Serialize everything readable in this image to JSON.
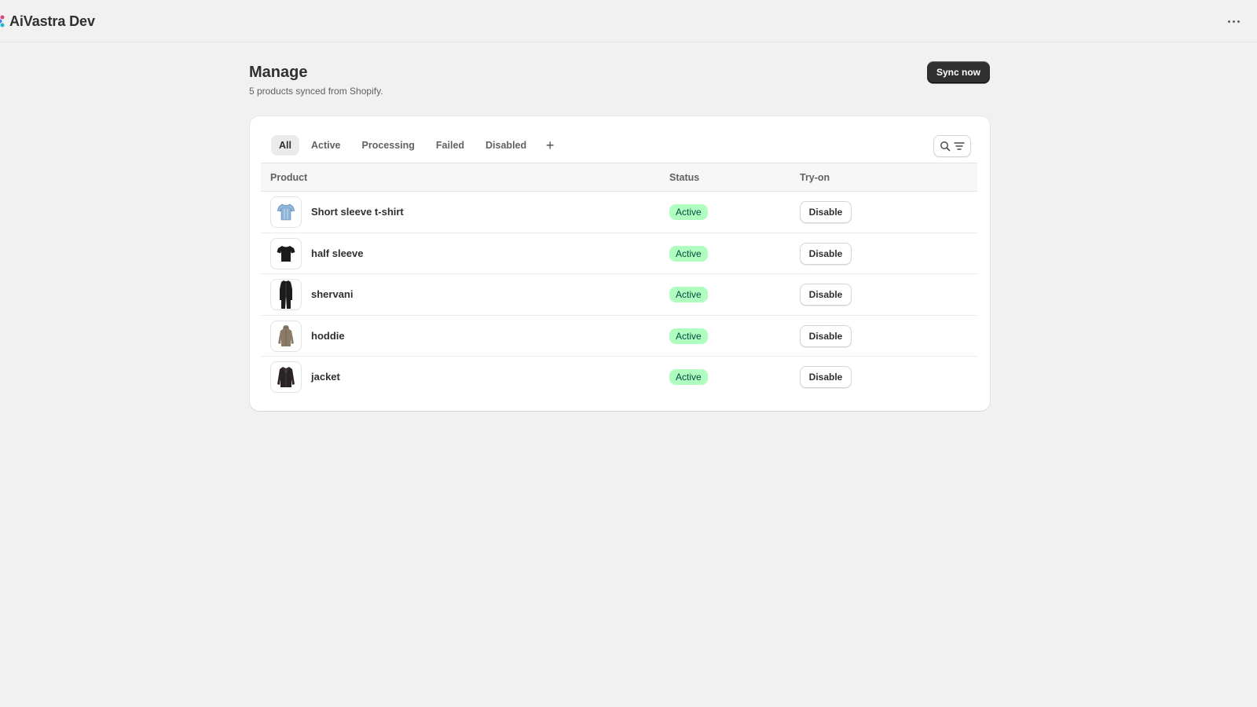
{
  "app": {
    "title": "AiVastra Dev",
    "more_icon": "more-horizontal-icon"
  },
  "page": {
    "title": "Manage",
    "subtitle": "5 products synced from Shopify.",
    "sync_label": "Sync now"
  },
  "tabs": [
    {
      "label": "All",
      "selected": true
    },
    {
      "label": "Active",
      "selected": false
    },
    {
      "label": "Processing",
      "selected": false
    },
    {
      "label": "Failed",
      "selected": false
    },
    {
      "label": "Disabled",
      "selected": false
    }
  ],
  "tab_add_label": "+",
  "table": {
    "headers": {
      "product": "Product",
      "status": "Status",
      "tryon": "Try-on"
    },
    "rows": [
      {
        "name": "Short sleeve t-shirt",
        "status": "Active",
        "action": "Disable",
        "thumb_icon": "tshirt-icon",
        "thumb_color": "#8fb4d9"
      },
      {
        "name": "half sleeve",
        "status": "Active",
        "action": "Disable",
        "thumb_icon": "tshirt-icon",
        "thumb_color": "#1a1a1a"
      },
      {
        "name": "shervani",
        "status": "Active",
        "action": "Disable",
        "thumb_icon": "long-coat-icon",
        "thumb_color": "#1c1c1c"
      },
      {
        "name": "hoddie",
        "status": "Active",
        "action": "Disable",
        "thumb_icon": "hoodie-icon",
        "thumb_color": "#8a7a68"
      },
      {
        "name": "jacket",
        "status": "Active",
        "action": "Disable",
        "thumb_icon": "jacket-icon",
        "thumb_color": "#2a2324"
      }
    ]
  },
  "colors": {
    "background": "#f1f1f1",
    "primary_button": "#303030",
    "active_badge_bg": "#affebf",
    "active_badge_text": "#014b40"
  }
}
